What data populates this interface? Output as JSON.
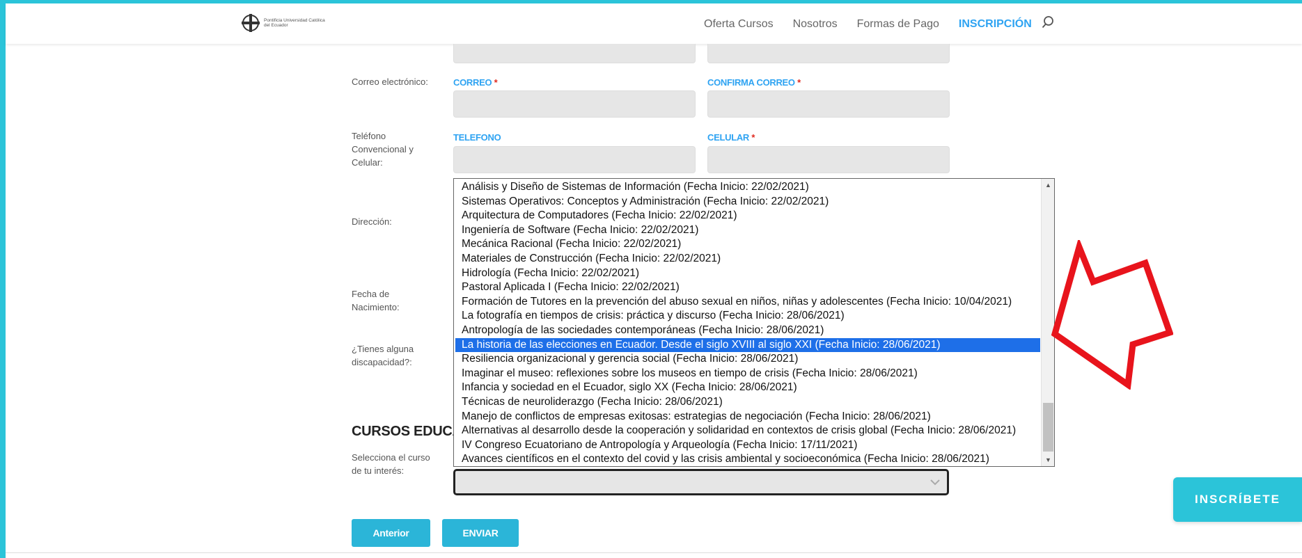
{
  "header": {
    "logo_text": "Pontificia Universidad Católica del Ecuador",
    "nav": [
      {
        "label": "Oferta Cursos"
      },
      {
        "label": "Nosotros"
      },
      {
        "label": "Formas de Pago"
      },
      {
        "label": "INSCRIPCIÓN"
      }
    ]
  },
  "form": {
    "email_row_label": "Correo electrónico:",
    "correo_label": "CORREO",
    "confirma_correo_label": "CONFIRMA CORREO",
    "required_mark": "*",
    "phone_row_label": "Teléfono Convencional y Celular:",
    "telefono_label": "TELEFONO",
    "celular_label": "CELULAR",
    "direccion_label": "Dirección:",
    "fecha_nacimiento_label": "Fecha de Nacimiento:",
    "discapacidad_label": "¿Tienes alguna discapacidad?:",
    "section_title": "CURSOS EDUCACIÓN CONTINUA",
    "course_select_label": "Selecciona el curso de tu interés:"
  },
  "dropdown": {
    "options": [
      "Análisis y Diseño de Sistemas de Información (Fecha Inicio: 22/02/2021)",
      "Sistemas Operativos: Conceptos y Administración (Fecha Inicio: 22/02/2021)",
      "Arquitectura de Computadores (Fecha Inicio: 22/02/2021)",
      "Ingeniería de Software (Fecha Inicio: 22/02/2021)",
      "Mecánica Racional (Fecha Inicio: 22/02/2021)",
      "Materiales de Construcción (Fecha Inicio: 22/02/2021)",
      "Hidrología (Fecha Inicio: 22/02/2021)",
      "Pastoral Aplicada I (Fecha Inicio: 22/02/2021)",
      "Formación de Tutores en la prevención del abuso sexual en niños, niñas y adolescentes (Fecha Inicio: 10/04/2021)",
      "La fotografía en tiempos de crisis: práctica y discurso (Fecha Inicio: 28/06/2021)",
      "Antropología de las sociedades contemporáneas (Fecha Inicio: 28/06/2021)",
      "La historia de las elecciones en Ecuador. Desde el siglo XVIII al siglo XXI (Fecha Inicio: 28/06/2021)",
      "Resiliencia organizacional y gerencia social (Fecha Inicio: 28/06/2021)",
      "Imaginar el museo: reflexiones sobre los museos en tiempo de crisis (Fecha Inicio: 28/06/2021)",
      "Infancia y sociedad en el Ecuador, siglo XX (Fecha Inicio: 28/06/2021)",
      "Técnicas de neuroliderazgo (Fecha Inicio: 28/06/2021)",
      "Manejo de conflictos de empresas exitosas: estrategias de negociación (Fecha Inicio: 28/06/2021)",
      "Alternativas al desarrollo desde la cooperación y solidaridad en contextos de crisis global (Fecha Inicio: 28/06/2021)",
      "IV Congreso Ecuatoriano de Antropología y Arqueología (Fecha Inicio: 17/11/2021)",
      "Avances científicos en el contexto del covid y las crisis ambiental y socioeconómica (Fecha Inicio: 28/06/2021)"
    ],
    "selected_index": 11
  },
  "buttons": {
    "anterior": "Anterior",
    "enviar": "ENVIAR",
    "inscribete": "INSCRÍBETE"
  },
  "colors": {
    "accent": "#2bc4d9",
    "label_blue": "#2ea3f2",
    "selection": "#1e6fe8",
    "annotation_arrow": "#e8141c"
  }
}
